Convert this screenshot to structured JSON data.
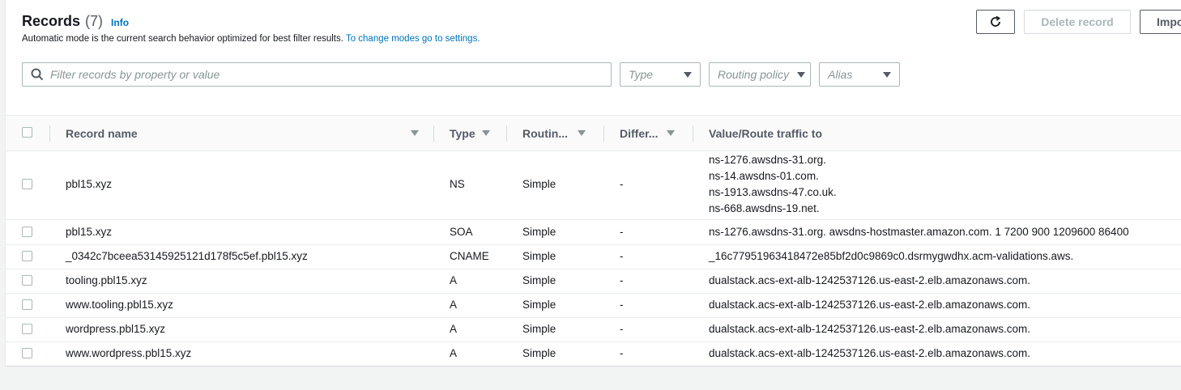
{
  "header": {
    "title": "Records",
    "count": "(7)",
    "info": "Info",
    "subtitle": "Automatic mode is the current search behavior optimized for best filter results.",
    "subtitle_link": "To change modes go to settings.",
    "buttons": {
      "delete": "Delete record",
      "import": "Impo"
    }
  },
  "filters": {
    "search_placeholder": "Filter records by property or value",
    "type_placeholder": "Type",
    "routing_placeholder": "Routing policy",
    "alias_placeholder": "Alias"
  },
  "table": {
    "columns": [
      "Record name",
      "Type",
      "Routin...",
      "Differ...",
      "Value/Route traffic to"
    ],
    "rows": [
      {
        "name": "pbl15.xyz",
        "type": "NS",
        "routing": "Simple",
        "differ": "-",
        "values": [
          "ns-1276.awsdns-31.org.",
          "ns-14.awsdns-01.com.",
          "ns-1913.awsdns-47.co.uk.",
          "ns-668.awsdns-19.net."
        ]
      },
      {
        "name": "pbl15.xyz",
        "type": "SOA",
        "routing": "Simple",
        "differ": "-",
        "values": [
          "ns-1276.awsdns-31.org. awsdns-hostmaster.amazon.com. 1 7200 900 1209600 86400"
        ]
      },
      {
        "name": "_0342c7bceea53145925121d178f5c5ef.pbl15.xyz",
        "type": "CNAME",
        "routing": "Simple",
        "differ": "-",
        "values": [
          "_16c77951963418472e85bf2d0c9869c0.dsrmygwdhx.acm-validations.aws."
        ]
      },
      {
        "name": "tooling.pbl15.xyz",
        "type": "A",
        "routing": "Simple",
        "differ": "-",
        "values": [
          "dualstack.acs-ext-alb-1242537126.us-east-2.elb.amazonaws.com."
        ]
      },
      {
        "name": "www.tooling.pbl15.xyz",
        "type": "A",
        "routing": "Simple",
        "differ": "-",
        "values": [
          "dualstack.acs-ext-alb-1242537126.us-east-2.elb.amazonaws.com."
        ]
      },
      {
        "name": "wordpress.pbl15.xyz",
        "type": "A",
        "routing": "Simple",
        "differ": "-",
        "values": [
          "dualstack.acs-ext-alb-1242537126.us-east-2.elb.amazonaws.com."
        ]
      },
      {
        "name": "www.wordpress.pbl15.xyz",
        "type": "A",
        "routing": "Simple",
        "differ": "-",
        "values": [
          "dualstack.acs-ext-alb-1242537126.us-east-2.elb.amazonaws.com."
        ]
      }
    ]
  },
  "icons": {
    "refresh": "refresh-icon",
    "search": "search-icon",
    "sort": "sort-caret-icon",
    "dropdown": "caret-down-icon"
  },
  "colors": {
    "link": "#0073bb",
    "text": "#16191f",
    "muted": "#545b64",
    "border": "#aab7b8",
    "background": "#f2f3f3"
  }
}
